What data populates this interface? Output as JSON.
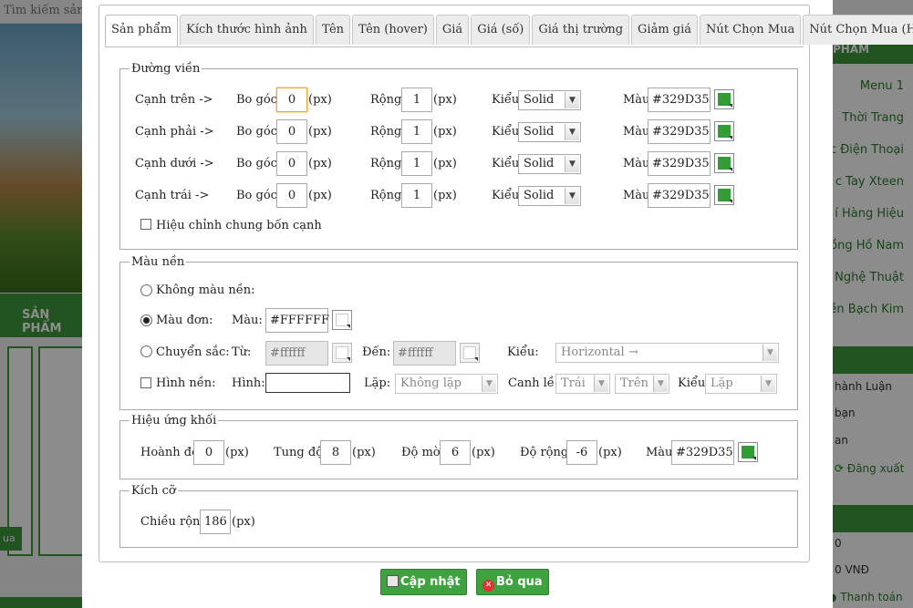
{
  "background": {
    "search_placeholder": "Tìm kiếm sản",
    "left_section_title": "SẢN PHẨM",
    "left_buy_label": "ua",
    "right_section_title": "PHẨM",
    "right_menu": [
      "Menu 1",
      "Thời Trang",
      "c Điện Thoại",
      "c Tay Xteen",
      "í Hàng Hiệu",
      "ồng Hồ Nam",
      "Nghệ Thuật",
      "ền Bạch Kim"
    ],
    "right_links": [
      "hành Luận",
      "bạn",
      "an"
    ],
    "logout_label": "Đăng xuất",
    "cart_count": "0",
    "cart_total": "0 VNĐ",
    "checkout_label": "Thanh toán"
  },
  "tabs": [
    "Sản phẩm",
    "Kích thước hình ảnh",
    "Tên",
    "Tên (hover)",
    "Giá",
    "Giá (số)",
    "Giá thị trường",
    "Giảm giá",
    "Nút Chọn Mua",
    "Nút Chọn Mua (Hover)"
  ],
  "border_section": {
    "legend": "Đường viền",
    "rows": [
      {
        "side": "Cạnh trên ->",
        "radius_label": "Bo góc:",
        "radius": "0",
        "unit": "(px)",
        "width_label": "Rộng:",
        "width": "1",
        "style_label": "Kiểu:",
        "style": "Solid",
        "color_label": "Màu:",
        "color": "#329D35"
      },
      {
        "side": "Cạnh phải ->",
        "radius_label": "Bo góc:",
        "radius": "0",
        "unit": "(px)",
        "width_label": "Rộng:",
        "width": "1",
        "style_label": "Kiểu:",
        "style": "Solid",
        "color_label": "Màu:",
        "color": "#329D35"
      },
      {
        "side": "Cạnh dưới ->",
        "radius_label": "Bo góc:",
        "radius": "0",
        "unit": "(px)",
        "width_label": "Rộng:",
        "width": "1",
        "style_label": "Kiểu:",
        "style": "Solid",
        "color_label": "Màu:",
        "color": "#329D35"
      },
      {
        "side": "Cạnh trái ->",
        "radius_label": "Bo góc:",
        "radius": "0",
        "unit": "(px)",
        "width_label": "Rộng:",
        "width": "1",
        "style_label": "Kiểu:",
        "style": "Solid",
        "color_label": "Màu:",
        "color": "#329D35"
      }
    ],
    "all_sides_label": "Hiệu chỉnh chung bốn cạnh"
  },
  "background_section": {
    "legend": "Màu nền",
    "no_color_label": "Không màu nền:",
    "solid_label": "Màu đơn:",
    "solid_color_label": "Màu:",
    "solid_color": "#FFFFFF",
    "gradient_label": "Chuyển sắc:",
    "from_label": "Từ:",
    "from_color": "#ffffff",
    "to_label": "Đến:",
    "to_color": "#ffffff",
    "gradient_type_label": "Kiểu:",
    "gradient_type": "Horizontal →",
    "image_label": "Hình nền:",
    "image_field_label": "Hình:",
    "image_value": "",
    "repeat_label": "Lặp:",
    "repeat": "Không lặp",
    "align_label": "Canh lề:",
    "align_h": "Trái",
    "align_v": "Trên",
    "kind_label": "Kiểu",
    "kind": "Lặp"
  },
  "shadow_section": {
    "legend": "Hiệu ứng khối",
    "h_label": "Hoành độ:",
    "h": "0",
    "v_label": "Tung độ:",
    "v": "8",
    "blur_label": "Độ mờ:",
    "blur": "6",
    "spread_label": "Độ rộng:",
    "spread": "-6",
    "unit": "(px)",
    "color_label": "Màu:",
    "color": "#329D35"
  },
  "size_section": {
    "legend": "Kích cỡ",
    "width_label": "Chiều rộng:",
    "width": "186",
    "unit": "(px)"
  },
  "buttons": {
    "update": "Cập nhật",
    "cancel": "Bỏ qua"
  },
  "colors": {
    "accent": "#329D35",
    "button": "#3ea33e"
  }
}
